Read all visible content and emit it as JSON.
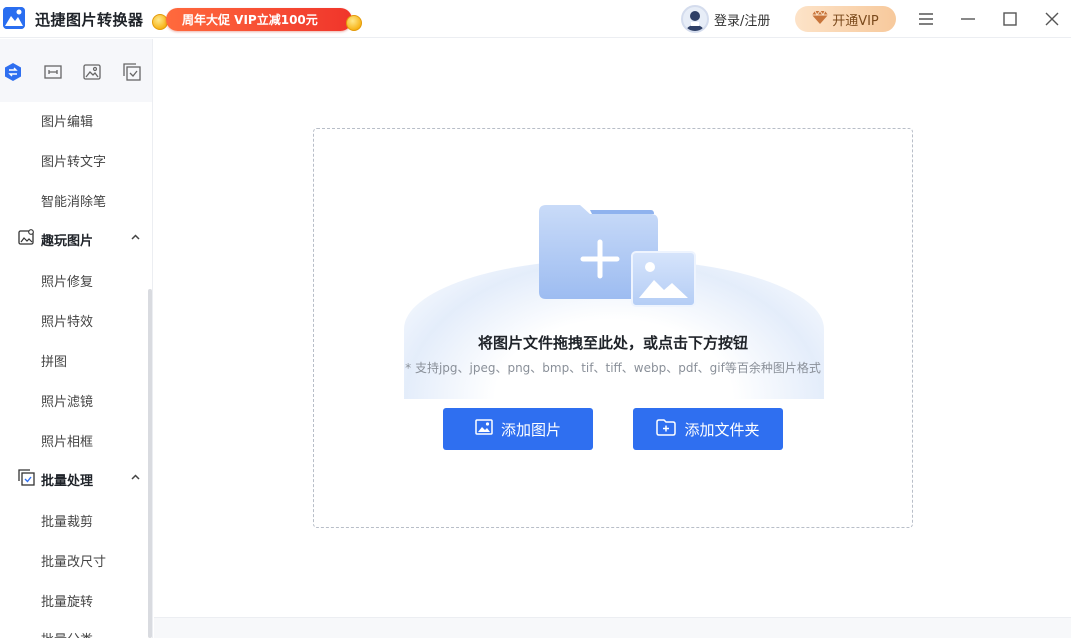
{
  "app": {
    "title": "迅捷图片转换器"
  },
  "promo": {
    "text": "周年大促 VIP立减100元"
  },
  "header": {
    "login_label": "登录/注册",
    "vip_label": "开通VIP"
  },
  "sidebar": {
    "top_items": [
      "图片编辑",
      "图片转文字",
      "智能消除笔"
    ],
    "groups": [
      {
        "title": "趣玩图片",
        "items": [
          "照片修复",
          "照片特效",
          "拼图",
          "照片滤镜",
          "照片相框"
        ]
      },
      {
        "title": "批量处理",
        "items": [
          "批量裁剪",
          "批量改尺寸",
          "批量旋转",
          "批量分类"
        ]
      }
    ]
  },
  "dropzone": {
    "title": "将图片文件拖拽至此处，或点击下方按钮",
    "subtitle": "* 支持jpg、jpeg、png、bmp、tif、tiff、webp、pdf、gif等百余种图片格式",
    "add_image_label": "添加图片",
    "add_folder_label": "添加文件夹"
  },
  "colors": {
    "accent": "#2f6ff0",
    "promo": "#f0352b",
    "vip": "#f7c99c"
  },
  "icons": [
    "app-logo-icon",
    "coin-icon",
    "user-avatar-icon",
    "diamond-icon",
    "menu-icon",
    "minimize-icon",
    "maximize-icon",
    "close-icon",
    "convert-icon",
    "crop-icon",
    "image-icon",
    "checklist-icon",
    "folder-add-icon",
    "add-image-icon"
  ]
}
